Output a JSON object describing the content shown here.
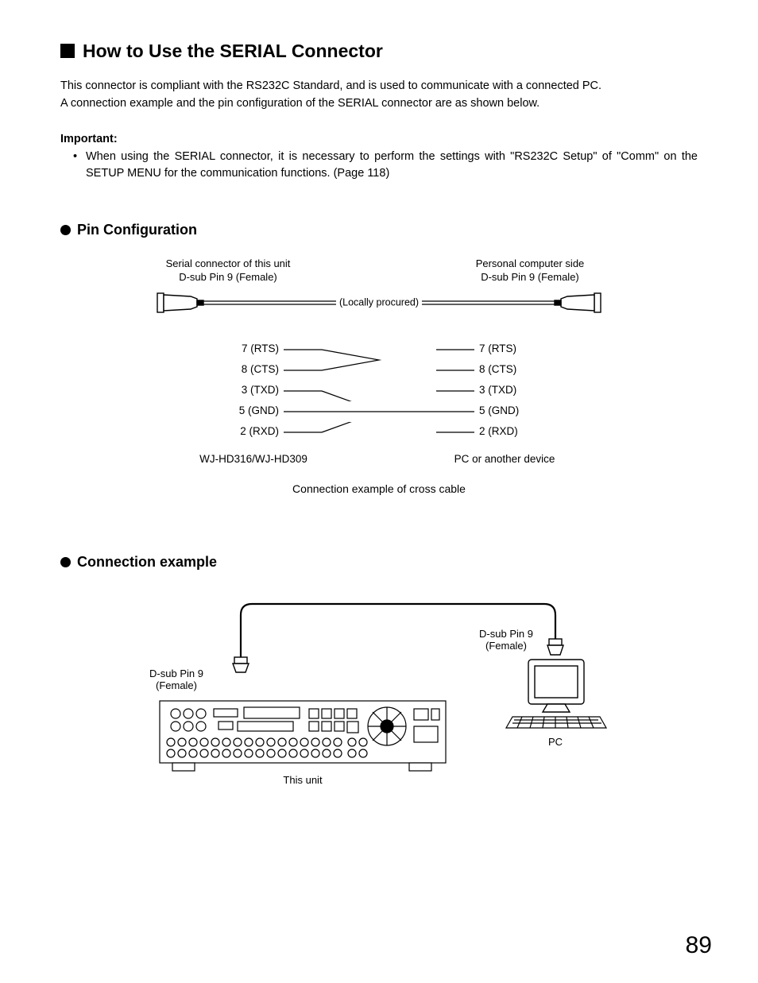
{
  "h1": "How to Use the SERIAL Connector",
  "intro1": "This connector is compliant with the RS232C Standard, and is used to communicate with a connected PC.",
  "intro2": "A connection example and the pin configuration of the SERIAL connector are as shown below.",
  "important_label": "Important:",
  "important_item": "When using the SERIAL connector, it is necessary to perform the settings with \"RS232C Setup\" of \"Comm\" on the SETUP MENU for the communication functions. (Page 118)",
  "h2_pin": "Pin Configuration",
  "conn_left_l1": "Serial connector of this unit",
  "conn_left_l2": "D-sub Pin 9 (Female)",
  "conn_right_l1": "Personal computer side",
  "conn_right_l2": "D-sub Pin 9 (Female)",
  "locally": "(Locally procured)",
  "pins_left": [
    "7 (RTS)",
    "8 (CTS)",
    "3 (TXD)",
    "5 (GND)",
    "2 (RXD)"
  ],
  "pins_right": [
    "7 (RTS)",
    "8 (CTS)",
    "3 (TXD)",
    "5 (GND)",
    "2 (RXD)"
  ],
  "pin_bot_left": "WJ-HD316/WJ-HD309",
  "pin_bot_right": "PC or another device",
  "cross_caption": "Connection example of cross cable",
  "h2_conn": "Connection example",
  "ex_left_l1": "D-sub Pin 9",
  "ex_left_l2": "(Female)",
  "ex_right_l1": "D-sub Pin 9",
  "ex_right_l2": "(Female)",
  "ex_pc": "PC",
  "ex_unit": "This unit",
  "page_num": "89"
}
